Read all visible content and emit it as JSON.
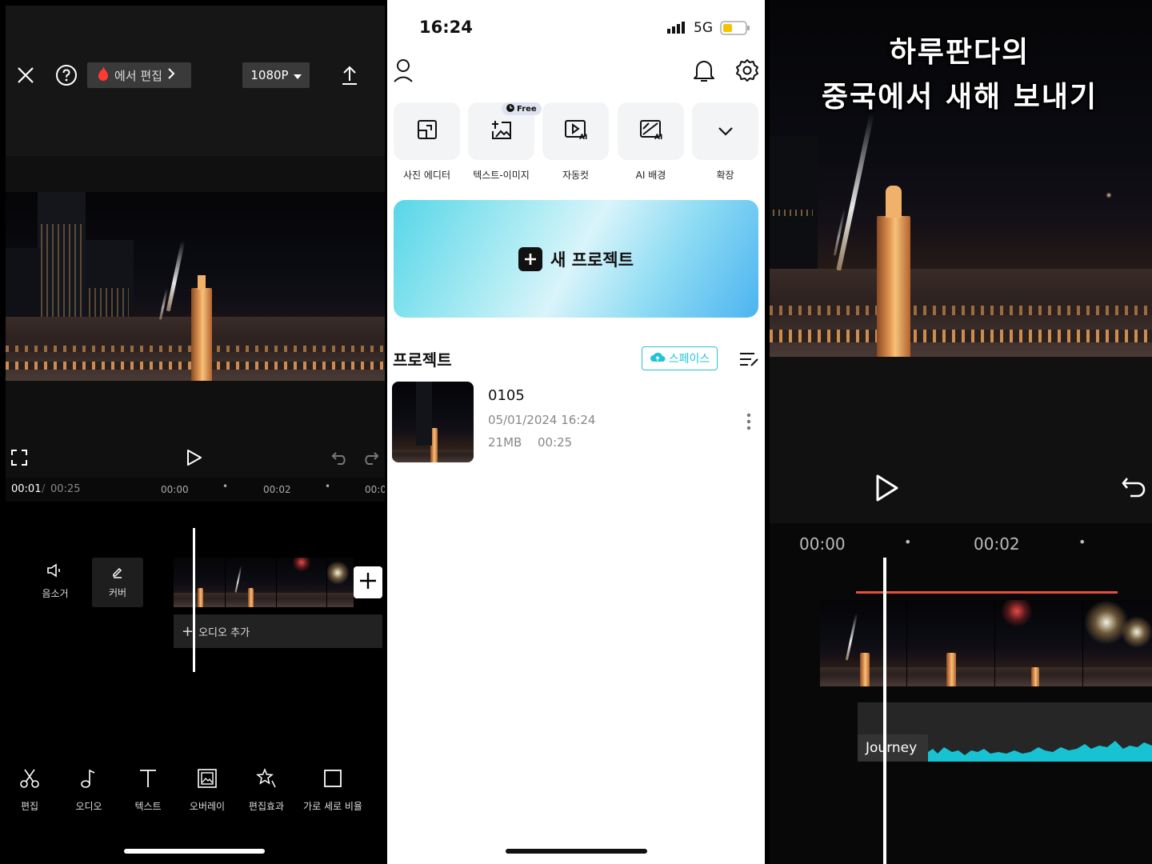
{
  "left": {
    "edit_chip_label": "에서 편집",
    "resolution": "1080P",
    "time_current": "00:01",
    "time_separator": "/",
    "time_total": "00:25",
    "ruler": [
      "00:00",
      "00:02",
      "00:0"
    ],
    "mute_label": "음소거",
    "cover_label": "커버",
    "add_audio_label": "오디오 추가",
    "tools": [
      {
        "label": "편집",
        "icon": "scissors-icon"
      },
      {
        "label": "오디오",
        "icon": "music-note-icon"
      },
      {
        "label": "텍스트",
        "icon": "text-icon"
      },
      {
        "label": "오버레이",
        "icon": "overlay-icon"
      },
      {
        "label": "편집효과",
        "icon": "effects-icon"
      },
      {
        "label": "가로 세로 비율",
        "icon": "aspect-ratio-icon"
      }
    ]
  },
  "middle": {
    "status_time": "16:24",
    "network": "5G",
    "quick_actions": [
      {
        "label": "사진 에디터",
        "icon": "photo-editor-icon"
      },
      {
        "label": "텍스트-이미지",
        "icon": "text-to-image-icon",
        "badge": "Free"
      },
      {
        "label": "자동컷",
        "icon": "auto-cut-icon"
      },
      {
        "label": "AI 배경",
        "icon": "ai-background-icon"
      },
      {
        "label": "확장",
        "icon": "chevron-down-icon"
      }
    ],
    "new_project_label": "새 프로젝트",
    "projects_heading": "프로젝트",
    "space_label": "스페이스",
    "project": {
      "name": "0105",
      "date": "05/01/2024 16:24",
      "size": "21MB",
      "duration": "00:25"
    }
  },
  "right": {
    "title_line1": "하루판다의",
    "title_line2": "중국에서 새해 보내기",
    "ruler": [
      "00:00",
      "00:02"
    ],
    "audio_track_label": "Journey"
  },
  "colors": {
    "accent_cyan": "#21c4d6",
    "audio_wave": "#17c3d3",
    "red_line": "#e5503c",
    "fire_icon": "#ff3b30"
  }
}
